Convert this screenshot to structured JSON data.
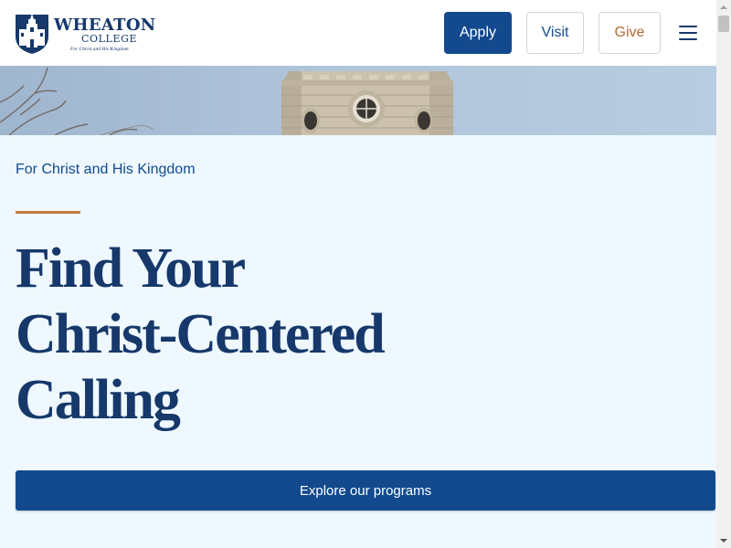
{
  "header": {
    "logo": {
      "wordmark": "WHEATON",
      "subword": "COLLEGE",
      "tagline": "For Christ and His Kingdom",
      "icon": "college-crest-icon"
    },
    "buttons": {
      "apply": "Apply",
      "visit": "Visit",
      "give": "Give"
    },
    "menu_icon": "hamburger-menu-icon"
  },
  "hero": {
    "image": "stone-tower-photo"
  },
  "main": {
    "eyebrow": "For Christ and His Kingdom",
    "headline_lines": [
      "Find Your",
      "Christ-Centered",
      "Calling"
    ],
    "cta": "Explore our programs"
  },
  "colors": {
    "navy": "#134a8e",
    "heading": "#16386a",
    "accent": "#c47b3e",
    "give_text": "#b26a33",
    "background": "#eef8fe"
  }
}
